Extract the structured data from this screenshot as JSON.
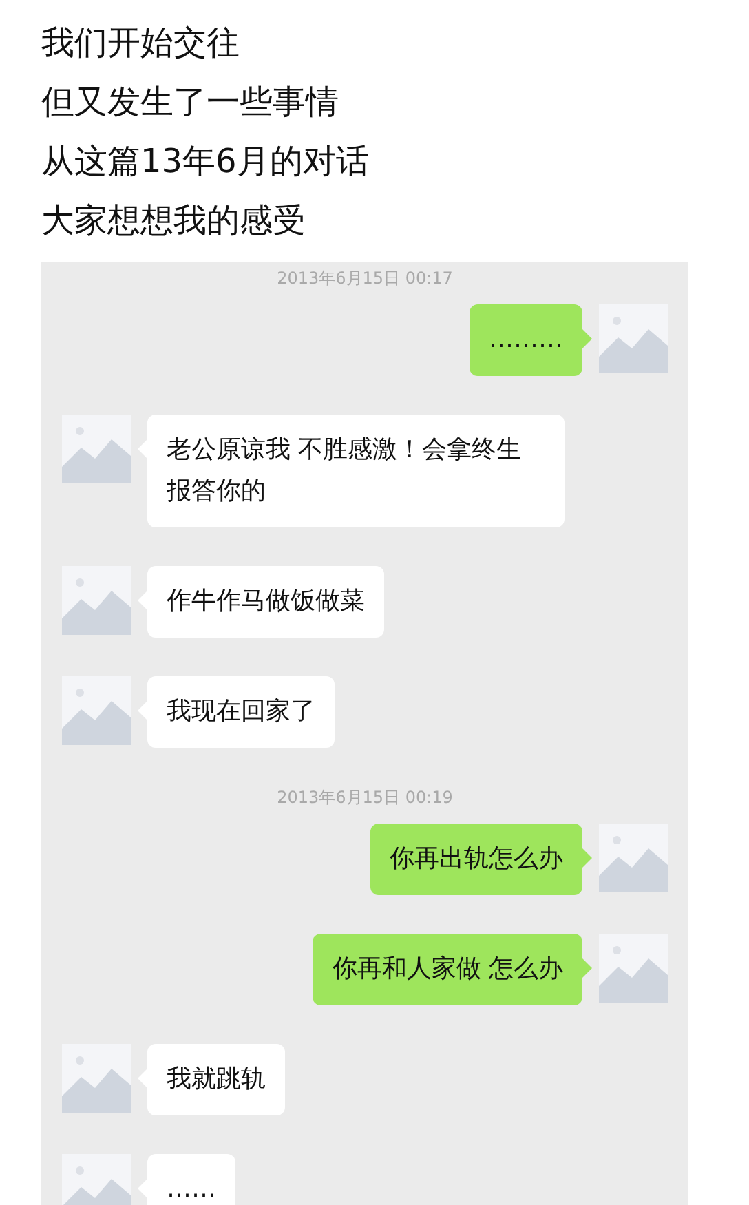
{
  "caption_lines": [
    "我们开始交往",
    "但又发生了一些事情",
    "从这篇13年6月的对话",
    "大家想想我的感受"
  ],
  "chat": [
    {
      "kind": "time",
      "text": "2013年6月15日 00:17"
    },
    {
      "kind": "sent",
      "text": "………"
    },
    {
      "kind": "received",
      "text": "老公原谅我 不胜感激！会拿终生报答你的"
    },
    {
      "kind": "received",
      "text": "作牛作马做饭做菜"
    },
    {
      "kind": "received",
      "text": "我现在回家了"
    },
    {
      "kind": "time",
      "text": "2013年6月15日 00:19"
    },
    {
      "kind": "sent",
      "text": "你再出轨怎么办"
    },
    {
      "kind": "sent",
      "text": "你再和人家做 怎么办"
    },
    {
      "kind": "received",
      "text": "我就跳轨"
    },
    {
      "kind": "received",
      "text": "……"
    }
  ]
}
